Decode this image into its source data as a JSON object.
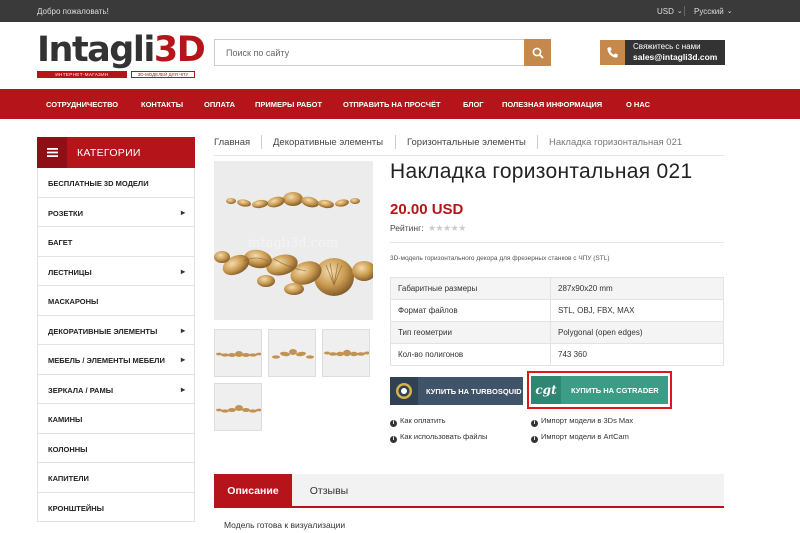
{
  "topbar": {
    "welcome": "Добро пожаловать!",
    "currency": "USD",
    "language": "Русский"
  },
  "logo": {
    "word_main": "Intagli",
    "word_accent": "3D",
    "tagline_left": "ИНТЕРНЕТ-МАГАЗИН",
    "tagline_right": "3D-МОДЕЛЕЙ ДЛЯ ЧПУ"
  },
  "search": {
    "placeholder": "Поиск по сайту"
  },
  "contact": {
    "line1": "Свяжитесь с нами",
    "email": "sales@intagli3d.com"
  },
  "nav": {
    "items": [
      "СОТРУДНИЧЕСТВО",
      "КОНТАКТЫ",
      "ОПЛАТА",
      "ПРИМЕРЫ РАБОТ",
      "ОТПРАВИТЬ НА ПРОСЧЁТ",
      "БЛОГ",
      "ПОЛЕЗНАЯ ИНФОРМАЦИЯ",
      "О НАС"
    ]
  },
  "sidebar": {
    "title": "КАТЕГОРИИ",
    "items": [
      {
        "label": "БЕСПЛАТНЫЕ 3D МОДЕЛИ",
        "arrow": ""
      },
      {
        "label": "РОЗЕТКИ",
        "arrow": "▸"
      },
      {
        "label": "БАГЕТ",
        "arrow": ""
      },
      {
        "label": "ЛЕСТНИЦЫ",
        "arrow": "▸"
      },
      {
        "label": "МАСКАРОНЫ",
        "arrow": ""
      },
      {
        "label": "ДЕКОРАТИВНЫЕ ЭЛЕМЕНТЫ",
        "arrow": "▸"
      },
      {
        "label": "МЕБЕЛЬ / ЭЛЕМЕНТЫ МЕБЕЛИ",
        "arrow": "▸"
      },
      {
        "label": "ЗЕРКАЛА / РАМЫ",
        "arrow": "▸"
      },
      {
        "label": "КАМИНЫ",
        "arrow": ""
      },
      {
        "label": "КОЛОННЫ",
        "arrow": ""
      },
      {
        "label": "КАПИТЕЛИ",
        "arrow": ""
      },
      {
        "label": "КРОНШТЕЙНЫ",
        "arrow": ""
      }
    ]
  },
  "breadcrumb": {
    "items": [
      "Главная",
      "Декоративные элементы",
      "Горизонтальные элементы",
      "Накладка горизонтальная 021"
    ]
  },
  "gallery": {
    "watermark": "intagli3d.com"
  },
  "product": {
    "title": "Накладка горизонтальная 021",
    "price": "20.00 USD",
    "rating_label": "Рейтинг:",
    "rating_stars": "★★★★★",
    "description": "3D-модель горизонтального декора для фрезерных станков с ЧПУ (STL)",
    "specs": [
      {
        "key": "Габаритные размеры",
        "value": "287x90x20 mm"
      },
      {
        "key": "Формат файлов",
        "value": "STL, OBJ, FBX, MAX"
      },
      {
        "key": "Тип геометрии",
        "value": "Polygonal (open edges)"
      },
      {
        "key": "Кол-во полигонов",
        "value": "743 360"
      }
    ],
    "buy_turbosquid": "КУПИТЬ НА TURBOSQUID",
    "buy_cgtrader": "КУПИТЬ НА CGTRADER",
    "cgtrader_logo": "cgt",
    "links": {
      "how_to_pay": "Как оплатить",
      "how_to_use": "Как использовать файлы",
      "import_3dsmax": "Импорт модели в 3Ds Max",
      "import_artcam": "Импорт модели в ArtCam"
    }
  },
  "tabs": {
    "description": "Описание",
    "reviews": "Отзывы",
    "content": "Модель готова к визуализации"
  },
  "colors": {
    "brand_red": "#b5141b",
    "accent_gold": "#c58a4b",
    "cgtrader_green": "#3c9c86",
    "turbosquid_blue": "#3f5468",
    "highlight_red": "#e0161c"
  }
}
